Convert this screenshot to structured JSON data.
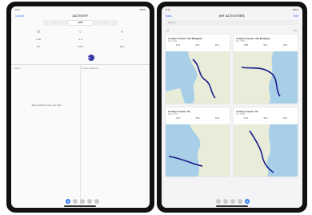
{
  "left": {
    "time": "9:41",
    "battery": "100%",
    "title": "ACTIVITY",
    "cancel": "Cancel",
    "segments": [
      "—",
      "GPS",
      "—"
    ],
    "grid": [
      {
        "icon": "↻",
        "label": ""
      },
      {
        "icon": "☼",
        "label": ""
      },
      {
        "icon": "◐",
        "label": ""
      },
      {
        "icon": "",
        "label": "0:00"
      },
      {
        "icon": "",
        "label": "0.0"
      },
      {
        "icon": "",
        "label": "—"
      },
      {
        "icon": "",
        "label": "km"
      },
      {
        "icon": "",
        "label": "km/h"
      },
      {
        "icon": "",
        "label": "bpm"
      }
    ],
    "record": "●",
    "section_left": "Menu",
    "section_right": "Routes  Markers",
    "center_note": "Start recording to see your track",
    "tabs": [
      "◉",
      "○",
      "○",
      "○",
      "○"
    ]
  },
  "right": {
    "time": "9:41",
    "battery": "100%",
    "title": "MY ACTIVITIES",
    "back": "Back",
    "edit": "Edit",
    "search_placeholder": "Search",
    "filter": "All",
    "sort": "Sort",
    "cards": [
      {
        "title": "Activity Tracker: Gili Meaghan",
        "subtitle": "Sat, 10:00",
        "stats": [
          "3:24",
          "61.5",
          "18.1"
        ]
      },
      {
        "title": "Activity Tracker: Gili Meaghan",
        "subtitle": "Sun, 08:40",
        "stats": [
          "2:58",
          "54.2",
          "18.3"
        ]
      },
      {
        "title": "Activity Tracker: 83",
        "subtitle": "Mon, 07:15",
        "stats": [
          "1:42",
          "28.6",
          "16.8"
        ]
      },
      {
        "title": "Activity Tracker: 84",
        "subtitle": "Tue, 06:50",
        "stats": [
          "2:10",
          "39.4",
          "18.2"
        ]
      }
    ],
    "tabs": [
      "○",
      "○",
      "○",
      "○",
      "◉"
    ]
  }
}
